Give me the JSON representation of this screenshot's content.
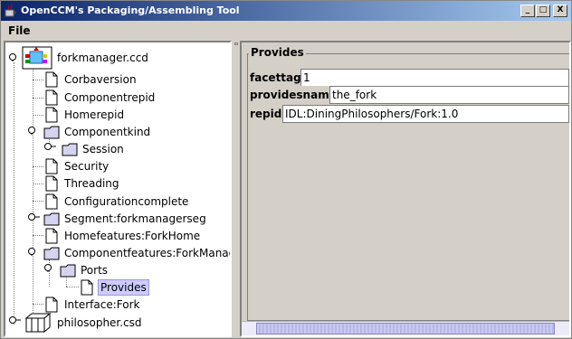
{
  "window": {
    "title": "OpenCCM's Packaging/Assembling Tool"
  },
  "window_controls": {
    "minimize": "_",
    "maximize": "□",
    "close": "X"
  },
  "menu": {
    "file": "File"
  },
  "tree": {
    "nodes": [
      {
        "label": "forkmanager.ccd",
        "icon": "assembly-icon"
      },
      {
        "label": "Corbaversion",
        "icon": "file-icon"
      },
      {
        "label": "Componentrepid",
        "icon": "file-icon"
      },
      {
        "label": "Homerepid",
        "icon": "file-icon"
      },
      {
        "label": "Componentkind",
        "icon": "folder-icon"
      },
      {
        "label": "Session",
        "icon": "folder-icon"
      },
      {
        "label": "Security",
        "icon": "file-icon"
      },
      {
        "label": "Threading",
        "icon": "file-icon"
      },
      {
        "label": "Configurationcomplete",
        "icon": "file-icon"
      },
      {
        "label": "Segment:forkmanagerseg",
        "icon": "folder-icon"
      },
      {
        "label": "Homefeatures:ForkHome",
        "icon": "file-icon"
      },
      {
        "label": "Componentfeatures:ForkManager",
        "icon": "folder-icon"
      },
      {
        "label": "Ports",
        "icon": "folder-icon"
      },
      {
        "label": "Provides",
        "icon": "file-icon"
      },
      {
        "label": "Interface:Fork",
        "icon": "file-icon"
      },
      {
        "label": "philosopher.csd",
        "icon": "package-icon"
      }
    ]
  },
  "form": {
    "group_title": "Provides",
    "fields": [
      {
        "label": "facettag :",
        "value": "1"
      },
      {
        "label": "providesname :",
        "value": "the_fork"
      },
      {
        "label": "repid :",
        "value": "IDL:DiningPhilosophers/Fork:1.0"
      }
    ]
  }
}
